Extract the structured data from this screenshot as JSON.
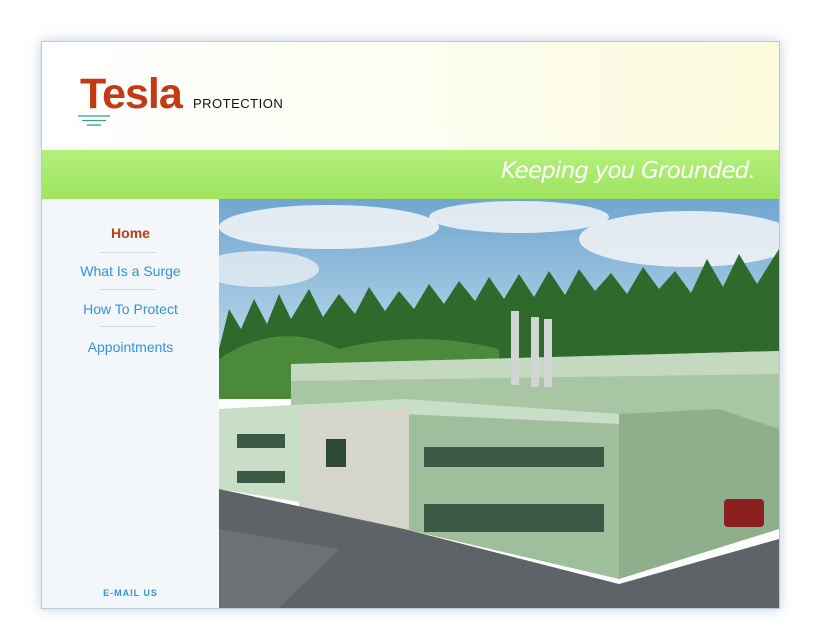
{
  "brand": {
    "name": "Tesla",
    "subtitle": "PROTECTION"
  },
  "banner": {
    "tagline": "Keeping you Grounded."
  },
  "nav": {
    "items": [
      {
        "label": "Home",
        "active": true
      },
      {
        "label": "What Is a Surge",
        "active": false
      },
      {
        "label": "How To Protect",
        "active": false
      },
      {
        "label": "Appointments",
        "active": false
      }
    ]
  },
  "footer": {
    "email_label": "E-MAIL US"
  },
  "colors": {
    "brand_red": "#c43a12",
    "banner_green": "#a8ea6c",
    "link_blue": "#2f93e6",
    "sidebar_bg": "#f3f7f9"
  },
  "icons": [
    "grounding-lines-icon"
  ],
  "hero": {
    "subject": "building-photo"
  }
}
